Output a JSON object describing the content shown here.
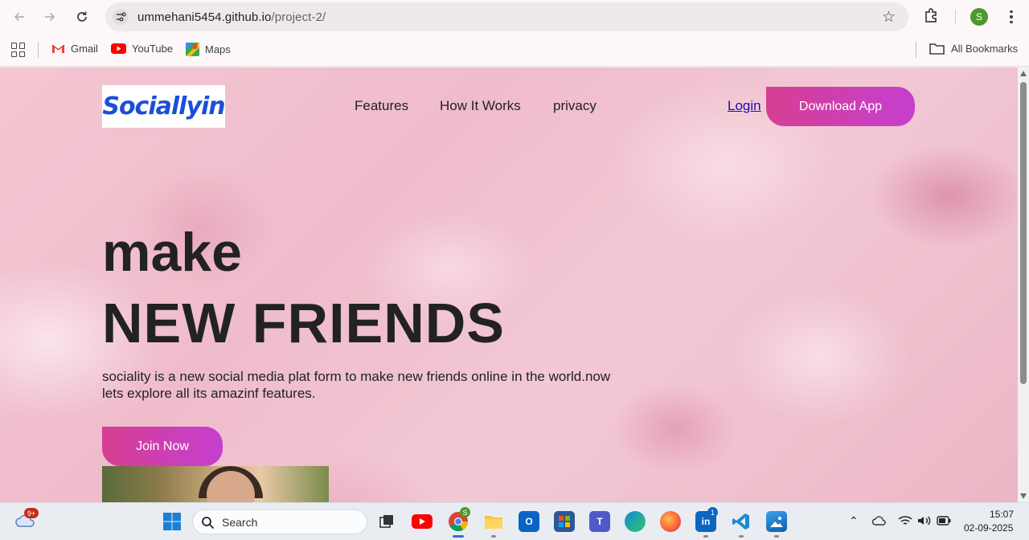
{
  "browser": {
    "url_host": "ummehani5454.github.io",
    "url_path": "/project-2/",
    "profile_initial": "S",
    "bookmarks": [
      {
        "label": "Gmail",
        "icon": "gmail-icon"
      },
      {
        "label": "YouTube",
        "icon": "youtube-icon"
      },
      {
        "label": "Maps",
        "icon": "maps-icon"
      }
    ],
    "all_bookmarks_label": "All Bookmarks"
  },
  "page": {
    "logo_text": "Sociallyin",
    "nav": [
      "Features",
      "How It Works",
      "privacy"
    ],
    "login_label": "Login",
    "download_label": "Download App",
    "hero_line1": "make",
    "hero_line2": "NEW FRIENDS",
    "hero_desc_line1": "sociality is a new social media plat form to make new friends online in the world.now",
    "hero_desc_line2": "lets explore all its amazinf features.",
    "join_label": "Join Now",
    "accent_gradient": [
      "#d63f92",
      "#c43fd0"
    ]
  },
  "taskbar": {
    "weather_badge": "9+",
    "search_label": "Search",
    "chrome_badge": "S",
    "linkedin_badge": "1",
    "time": "15:07",
    "date": "02-09-2025"
  }
}
